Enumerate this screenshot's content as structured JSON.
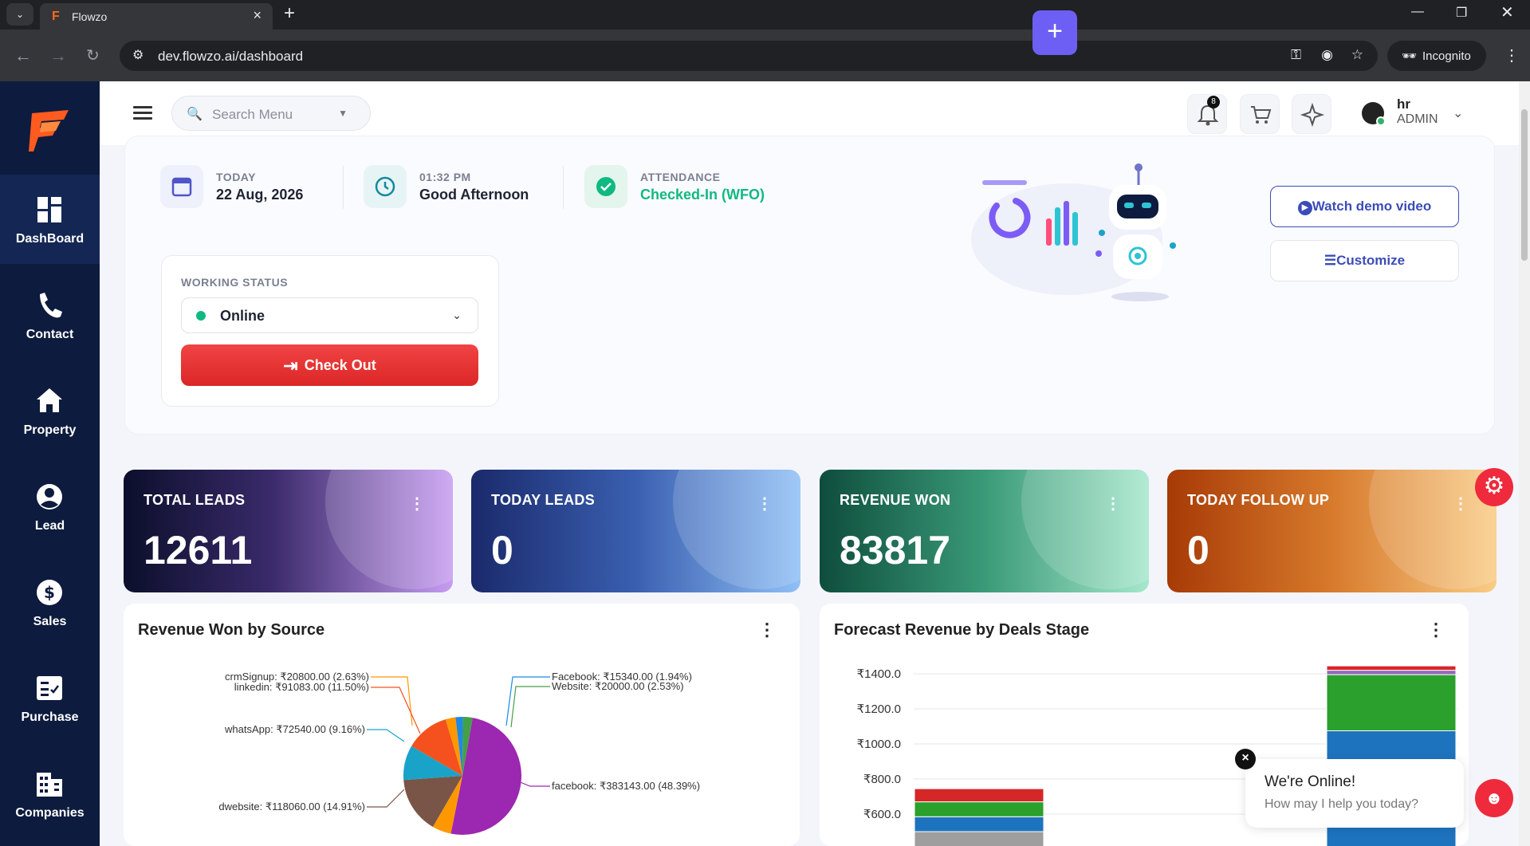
{
  "browser": {
    "tab_title": "Flowzo",
    "tab_favicon": "F",
    "url": "dev.flowzo.ai/dashboard",
    "incognito_label": "Incognito"
  },
  "sidebar": {
    "items": [
      {
        "label": "DashBoard",
        "icon": "dashboard-icon"
      },
      {
        "label": "Contact",
        "icon": "phone-icon"
      },
      {
        "label": "Property",
        "icon": "home-icon"
      },
      {
        "label": "Lead",
        "icon": "user-circle-icon"
      },
      {
        "label": "Sales",
        "icon": "dollar-icon"
      },
      {
        "label": "Purchase",
        "icon": "checklist-icon"
      },
      {
        "label": "Companies",
        "icon": "building-icon"
      }
    ]
  },
  "header": {
    "search_placeholder": "Search Menu",
    "notification_count": "8",
    "user_name": "hr",
    "user_role": "ADMIN"
  },
  "overview": {
    "today_label": "TODAY",
    "today_value": "22 Aug, 2026",
    "time_label": "01:32 PM",
    "greeting": "Good Afternoon",
    "attendance_label": "ATTENDANCE",
    "attendance_value": "Checked-In (WFO)",
    "working_status_label": "WORKING STATUS",
    "working_status_value": "Online",
    "checkout_label": "Check Out",
    "watch_demo_label": "Watch demo video",
    "customize_label": "Customize"
  },
  "stats": [
    {
      "title": "TOTAL LEADS",
      "value": "12611"
    },
    {
      "title": "TODAY LEADS",
      "value": "0"
    },
    {
      "title": "REVENUE WON",
      "value": "83817"
    },
    {
      "title": "TODAY FOLLOW UP",
      "value": "0"
    }
  ],
  "revenue_by_source": {
    "title": "Revenue Won by Source",
    "slices": [
      {
        "label": "facebook: ₹383143.00 (48.39%)",
        "pct": 48.39,
        "color": "#9c27b0"
      },
      {
        "label": "dwebsite: ₹118060.00 (14.91%)",
        "pct": 14.91,
        "color": "#795548"
      },
      {
        "label": "whatsApp: ₹72540.00 (9.16%)",
        "pct": 9.16,
        "color": "#1aa3c8"
      },
      {
        "label": "linkedin: ₹91083.00 (11.50%)",
        "pct": 11.5,
        "color": "#f4511e"
      },
      {
        "label": "crmSignup: ₹20800.00 (2.63%)",
        "pct": 2.63,
        "color": "#ff9800"
      },
      {
        "label": "Facebook: ₹15340.00 (1.94%)",
        "pct": 1.94,
        "color": "#1e88e5"
      },
      {
        "label": "Website: ₹20000.00 (2.53%)",
        "pct": 2.53,
        "color": "#43a047"
      }
    ],
    "slice_orange_extra_color": "#ff9800"
  },
  "forecast": {
    "title": "Forecast Revenue by Deals Stage",
    "y_ticks": [
      "₹1400.0",
      "₹1200.0",
      "₹1000.0",
      "₹800.0",
      "₹600.0"
    ]
  },
  "chart_data": {
    "type": "bar",
    "title": "Forecast Revenue by Deals Stage",
    "ylim": [
      400,
      1400
    ],
    "stacked": true,
    "bars": [
      {
        "segments": [
          {
            "color": "#9e9e9e",
            "value": 500
          },
          {
            "color": "#1e73be",
            "value": 585
          },
          {
            "color": "#2ca02c",
            "value": 670
          },
          {
            "color": "#d62728",
            "value": 745
          }
        ]
      },
      {
        "segments": [
          {
            "color": "#1e73be",
            "value": 1075
          },
          {
            "color": "#2ca02c",
            "value": 1395
          },
          {
            "color": "#9467bd",
            "value": 1420
          },
          {
            "color": "#d62728",
            "value": 1445
          }
        ]
      }
    ]
  },
  "chat": {
    "heading": "We're Online!",
    "subtext": "How may I help you today?"
  }
}
